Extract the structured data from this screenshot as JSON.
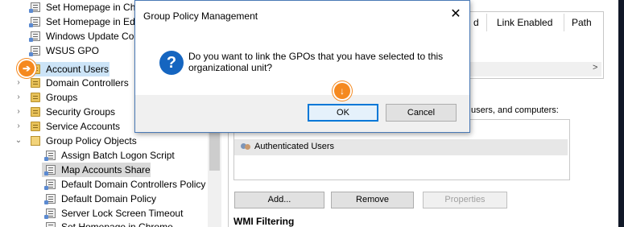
{
  "tree": {
    "items": [
      {
        "label": "Set Homepage in Chr",
        "icon": "gpo-icon"
      },
      {
        "label": "Set Homepage in Edg",
        "icon": "gpo-icon"
      },
      {
        "label": "Windows Update Cor",
        "icon": "gpo-icon"
      },
      {
        "label": "WSUS GPO",
        "icon": "gpo-icon"
      },
      {
        "label": "Account Users",
        "icon": "folder-icon"
      },
      {
        "label": "Domain Controllers",
        "icon": "folder-icon"
      },
      {
        "label": "Groups",
        "icon": "folder-icon"
      },
      {
        "label": "Security Groups",
        "icon": "folder-icon"
      },
      {
        "label": "Service Accounts",
        "icon": "folder-icon"
      },
      {
        "label": "Group Policy Objects",
        "icon": "folder-open-icon"
      },
      {
        "label": "Assign Batch Logon Script",
        "icon": "gpo-icon"
      },
      {
        "label": "Map Accounts Share",
        "icon": "gpo-icon"
      },
      {
        "label": "Default Domain Controllers Policy",
        "icon": "gpo-icon"
      },
      {
        "label": "Default Domain Policy",
        "icon": "gpo-icon"
      },
      {
        "label": "Server Lock Screen Timeout",
        "icon": "gpo-icon"
      },
      {
        "label": "Set Homepage in Chrome",
        "icon": "gpo-icon"
      }
    ]
  },
  "links": {
    "columns": {
      "d": "d",
      "link_enabled": "Link Enabled",
      "path": "Path"
    }
  },
  "security": {
    "filter_text": "users, and computers:",
    "entries": [
      "Authenticated Users"
    ],
    "add_label": "Add...",
    "remove_label": "Remove",
    "properties_label": "Properties"
  },
  "wmi": {
    "heading": "WMI Filtering"
  },
  "dialog": {
    "title": "Group Policy Management",
    "close_glyph": "✕",
    "message": "Do you want to link the GPOs that you have selected to this organizational unit?",
    "ok_label": "OK",
    "cancel_label": "Cancel"
  },
  "colors": {
    "accent": "#0078d7",
    "marker": "#f5891f",
    "selection": "#cce4f7"
  }
}
